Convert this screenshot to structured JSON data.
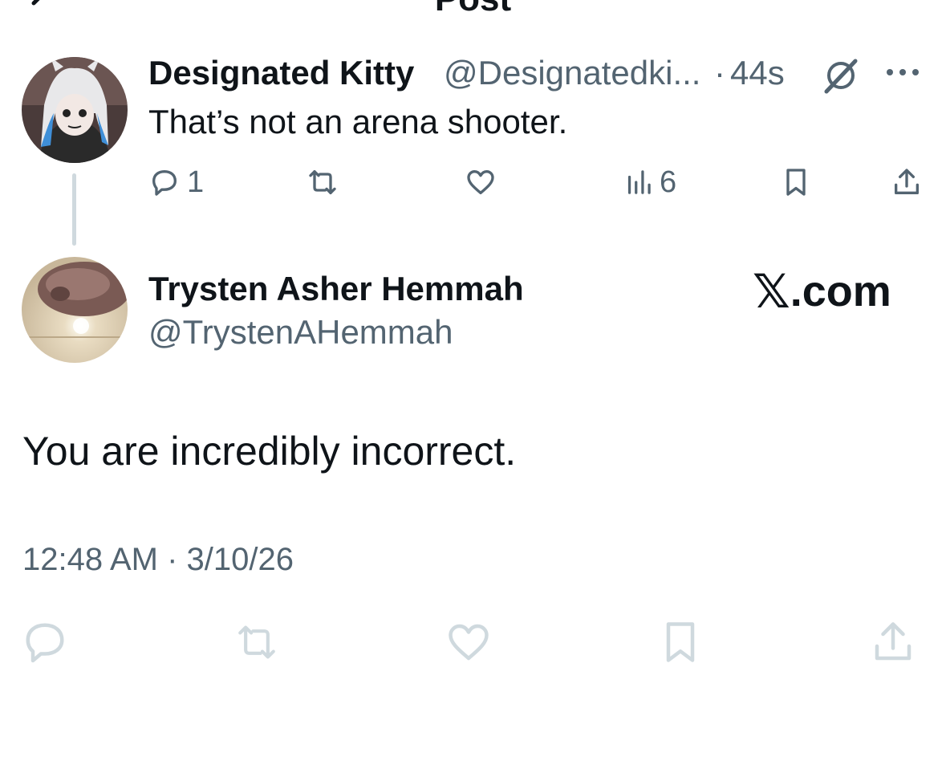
{
  "header": {
    "title": "Post",
    "back_icon": "arrow-left-icon",
    "more_icon": "more-horizontal-icon"
  },
  "parent_post": {
    "author_name": "Designated Kitty",
    "author_handle": "@Designatedki...",
    "separator": "·",
    "time_ago": "44s",
    "text": "That’s not an arena shooter.",
    "actions": {
      "reply_count": "1",
      "repost_count": "",
      "like_count": "",
      "views_count": "6"
    }
  },
  "main_post": {
    "author_name": "Trysten Asher Hemmah",
    "author_handle": "@TrystenAHemmah",
    "text": "You are incredibly incorrect.",
    "timestamp": "12:48 AM · 3/10/26"
  },
  "watermark": {
    "mark": "𝕏",
    "text": ".com"
  },
  "colors": {
    "text_primary": "#0f1419",
    "text_secondary": "#536471",
    "action_muted": "#cfd9de",
    "thread_line": "#cfd9de",
    "background": "#ffffff"
  }
}
